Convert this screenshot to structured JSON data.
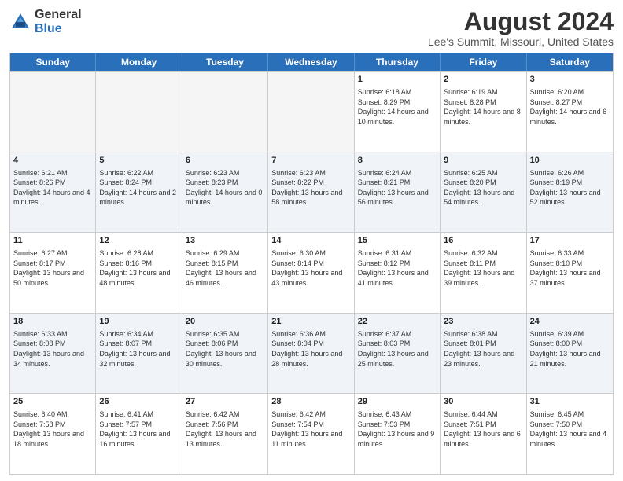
{
  "logo": {
    "general": "General",
    "blue": "Blue"
  },
  "title": "August 2024",
  "subtitle": "Lee's Summit, Missouri, United States",
  "days": [
    "Sunday",
    "Monday",
    "Tuesday",
    "Wednesday",
    "Thursday",
    "Friday",
    "Saturday"
  ],
  "rows": [
    [
      {
        "day": "",
        "info": "",
        "empty": true
      },
      {
        "day": "",
        "info": "",
        "empty": true
      },
      {
        "day": "",
        "info": "",
        "empty": true
      },
      {
        "day": "",
        "info": "",
        "empty": true
      },
      {
        "day": "1",
        "info": "Sunrise: 6:18 AM\nSunset: 8:29 PM\nDaylight: 14 hours and 10 minutes."
      },
      {
        "day": "2",
        "info": "Sunrise: 6:19 AM\nSunset: 8:28 PM\nDaylight: 14 hours and 8 minutes."
      },
      {
        "day": "3",
        "info": "Sunrise: 6:20 AM\nSunset: 8:27 PM\nDaylight: 14 hours and 6 minutes."
      }
    ],
    [
      {
        "day": "4",
        "info": "Sunrise: 6:21 AM\nSunset: 8:26 PM\nDaylight: 14 hours and 4 minutes."
      },
      {
        "day": "5",
        "info": "Sunrise: 6:22 AM\nSunset: 8:24 PM\nDaylight: 14 hours and 2 minutes."
      },
      {
        "day": "6",
        "info": "Sunrise: 6:23 AM\nSunset: 8:23 PM\nDaylight: 14 hours and 0 minutes."
      },
      {
        "day": "7",
        "info": "Sunrise: 6:23 AM\nSunset: 8:22 PM\nDaylight: 13 hours and 58 minutes."
      },
      {
        "day": "8",
        "info": "Sunrise: 6:24 AM\nSunset: 8:21 PM\nDaylight: 13 hours and 56 minutes."
      },
      {
        "day": "9",
        "info": "Sunrise: 6:25 AM\nSunset: 8:20 PM\nDaylight: 13 hours and 54 minutes."
      },
      {
        "day": "10",
        "info": "Sunrise: 6:26 AM\nSunset: 8:19 PM\nDaylight: 13 hours and 52 minutes."
      }
    ],
    [
      {
        "day": "11",
        "info": "Sunrise: 6:27 AM\nSunset: 8:17 PM\nDaylight: 13 hours and 50 minutes."
      },
      {
        "day": "12",
        "info": "Sunrise: 6:28 AM\nSunset: 8:16 PM\nDaylight: 13 hours and 48 minutes."
      },
      {
        "day": "13",
        "info": "Sunrise: 6:29 AM\nSunset: 8:15 PM\nDaylight: 13 hours and 46 minutes."
      },
      {
        "day": "14",
        "info": "Sunrise: 6:30 AM\nSunset: 8:14 PM\nDaylight: 13 hours and 43 minutes."
      },
      {
        "day": "15",
        "info": "Sunrise: 6:31 AM\nSunset: 8:12 PM\nDaylight: 13 hours and 41 minutes."
      },
      {
        "day": "16",
        "info": "Sunrise: 6:32 AM\nSunset: 8:11 PM\nDaylight: 13 hours and 39 minutes."
      },
      {
        "day": "17",
        "info": "Sunrise: 6:33 AM\nSunset: 8:10 PM\nDaylight: 13 hours and 37 minutes."
      }
    ],
    [
      {
        "day": "18",
        "info": "Sunrise: 6:33 AM\nSunset: 8:08 PM\nDaylight: 13 hours and 34 minutes."
      },
      {
        "day": "19",
        "info": "Sunrise: 6:34 AM\nSunset: 8:07 PM\nDaylight: 13 hours and 32 minutes."
      },
      {
        "day": "20",
        "info": "Sunrise: 6:35 AM\nSunset: 8:06 PM\nDaylight: 13 hours and 30 minutes."
      },
      {
        "day": "21",
        "info": "Sunrise: 6:36 AM\nSunset: 8:04 PM\nDaylight: 13 hours and 28 minutes."
      },
      {
        "day": "22",
        "info": "Sunrise: 6:37 AM\nSunset: 8:03 PM\nDaylight: 13 hours and 25 minutes."
      },
      {
        "day": "23",
        "info": "Sunrise: 6:38 AM\nSunset: 8:01 PM\nDaylight: 13 hours and 23 minutes."
      },
      {
        "day": "24",
        "info": "Sunrise: 6:39 AM\nSunset: 8:00 PM\nDaylight: 13 hours and 21 minutes."
      }
    ],
    [
      {
        "day": "25",
        "info": "Sunrise: 6:40 AM\nSunset: 7:58 PM\nDaylight: 13 hours and 18 minutes."
      },
      {
        "day": "26",
        "info": "Sunrise: 6:41 AM\nSunset: 7:57 PM\nDaylight: 13 hours and 16 minutes."
      },
      {
        "day": "27",
        "info": "Sunrise: 6:42 AM\nSunset: 7:56 PM\nDaylight: 13 hours and 13 minutes."
      },
      {
        "day": "28",
        "info": "Sunrise: 6:42 AM\nSunset: 7:54 PM\nDaylight: 13 hours and 11 minutes."
      },
      {
        "day": "29",
        "info": "Sunrise: 6:43 AM\nSunset: 7:53 PM\nDaylight: 13 hours and 9 minutes."
      },
      {
        "day": "30",
        "info": "Sunrise: 6:44 AM\nSunset: 7:51 PM\nDaylight: 13 hours and 6 minutes."
      },
      {
        "day": "31",
        "info": "Sunrise: 6:45 AM\nSunset: 7:50 PM\nDaylight: 13 hours and 4 minutes."
      }
    ]
  ]
}
